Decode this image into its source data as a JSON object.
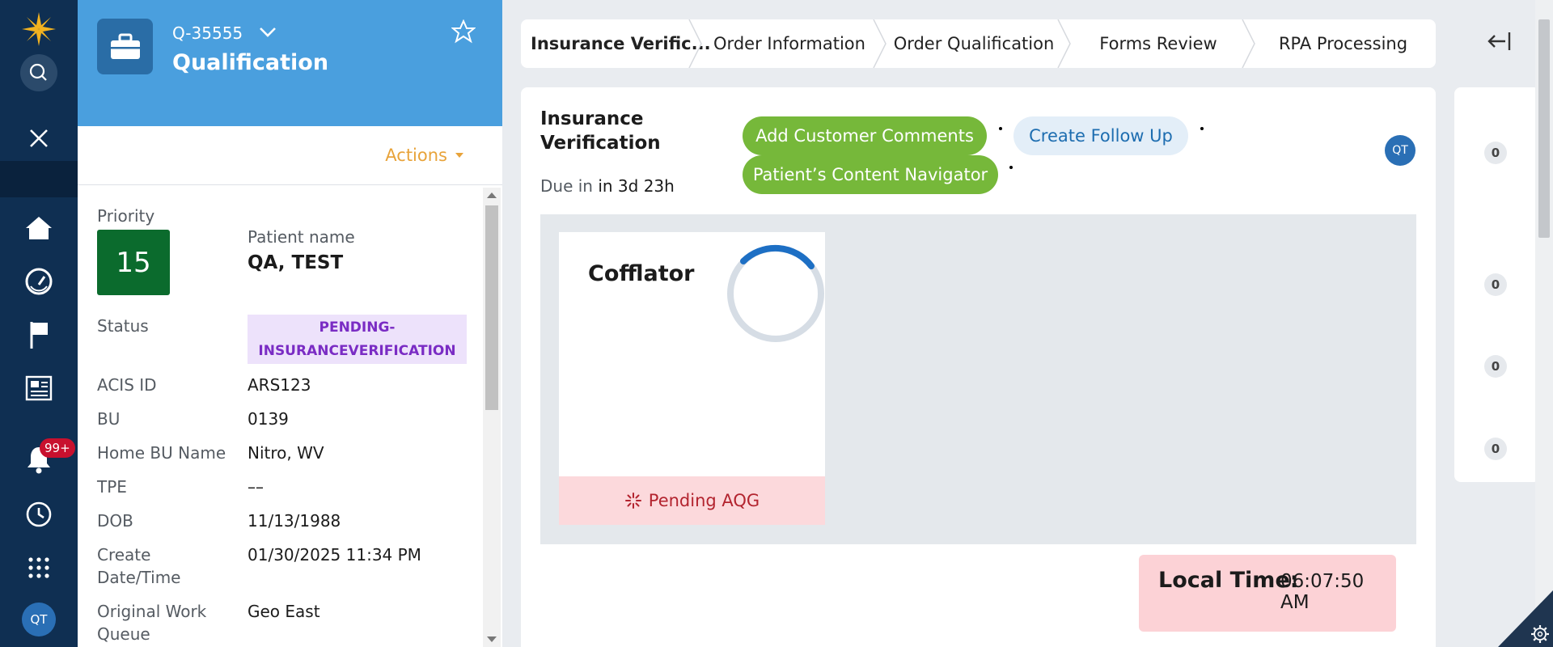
{
  "rail": {
    "items": [
      "logo",
      "search",
      "close",
      "home",
      "dashboard",
      "flag",
      "news",
      "notifications",
      "history",
      "apps",
      "profile"
    ],
    "notification_count": "99+",
    "avatar_initials": "QT"
  },
  "case": {
    "id": "Q-35555",
    "title": "Qualification",
    "actions_label": "Actions",
    "priority_label": "Priority",
    "priority_value": "15",
    "patient_label": "Patient name",
    "patient_value": "QA, TEST",
    "status_label": "Status",
    "status_value_line1": "PENDING-",
    "status_value_line2": "INSURANCEVERIFICATION",
    "fields": [
      {
        "label": "ACIS ID",
        "value": "ARS123"
      },
      {
        "label": "BU",
        "value": "0139"
      },
      {
        "label": "Home BU Name",
        "value": "Nitro, WV"
      },
      {
        "label": "TPE",
        "value": "––"
      },
      {
        "label": "DOB",
        "value": "11/13/1988"
      },
      {
        "label_line1": "Create",
        "label_line2": "Date/Time",
        "value": "01/30/2025 11:34 PM"
      },
      {
        "label_line1": "Original Work",
        "label_line2": "Queue",
        "value": "Geo East"
      }
    ]
  },
  "stages": [
    {
      "label": "Insurance Verific...",
      "active": true
    },
    {
      "label": "Order Information"
    },
    {
      "label": "Order Qualification"
    },
    {
      "label": "Forms Review"
    },
    {
      "label": "RPA Processing"
    }
  ],
  "main": {
    "title_line1": "Insurance",
    "title_line2": "Verification",
    "due_prefix": "Due in",
    "due_value": "in 3d 23h",
    "buttons": {
      "add_comments": "Add Customer Comments",
      "create_follow_up": "Create Follow Up",
      "content_navigator": "Patient’s Content Navigator"
    },
    "assignee_initials": "QT",
    "tile": {
      "title": "Cofflator",
      "status": "Pending AQG"
    },
    "local_time_label": "Local Time:",
    "local_time_value": "06:07:50 AM"
  },
  "utility_counts": [
    "0",
    "0",
    "0",
    "0"
  ],
  "colors": {
    "rail_bg": "#0f2f52",
    "header_bg": "#4a9fde",
    "priority_bg": "#0b6b2d",
    "status_chip_bg": "#ede2fb",
    "status_chip_text": "#7a2cc4",
    "green_button": "#76b83a",
    "pending_bg": "#fcd9dc",
    "local_time_bg": "#fcd2d6"
  }
}
